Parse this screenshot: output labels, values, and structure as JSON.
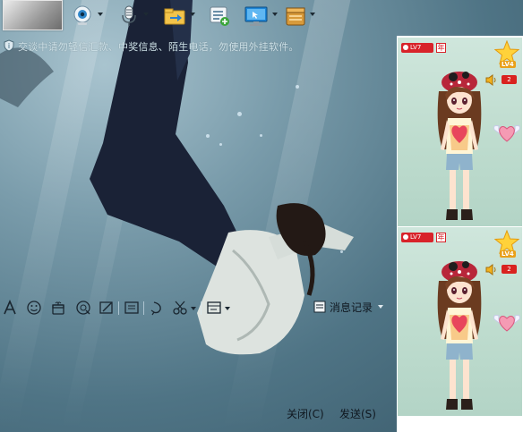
{
  "toolbar": {
    "items": [
      {
        "name": "video-call",
        "icon": "webcam-icon"
      },
      {
        "name": "voice-call",
        "icon": "microphone-icon"
      },
      {
        "name": "send-file",
        "icon": "folder-arrow-icon"
      },
      {
        "name": "create-discussion",
        "icon": "list-add-icon"
      },
      {
        "name": "remote-assistance",
        "icon": "monitor-icon"
      },
      {
        "name": "app",
        "icon": "box-icon"
      }
    ]
  },
  "notice": {
    "text": "交谈中请勿轻信汇款、中奖信息、陌生电话，勿使用外挂软件。"
  },
  "format_bar": {
    "icons": [
      "font-icon",
      "smiley-icon",
      "gift-icon",
      "magic-icon",
      "screen-draw-icon",
      "photo-icon",
      "shake-icon",
      "screenshot-icon",
      "more-icon"
    ],
    "history_label": "消息记录"
  },
  "buttons": {
    "close": "关闭(C)",
    "send": "发送(S)"
  },
  "show_panels": [
    {
      "level_tag": "LV7",
      "mark": "年",
      "star_level": "LV4",
      "count": "2"
    },
    {
      "level_tag": "LV7",
      "mark": "年",
      "star_level": "LV4",
      "count": "2"
    }
  ],
  "colors": {
    "panel_bg": "#ffffff",
    "show_bg": "#c2dfd1",
    "badge_red": "#d8232a",
    "accent_orange": "#e9a01a"
  }
}
